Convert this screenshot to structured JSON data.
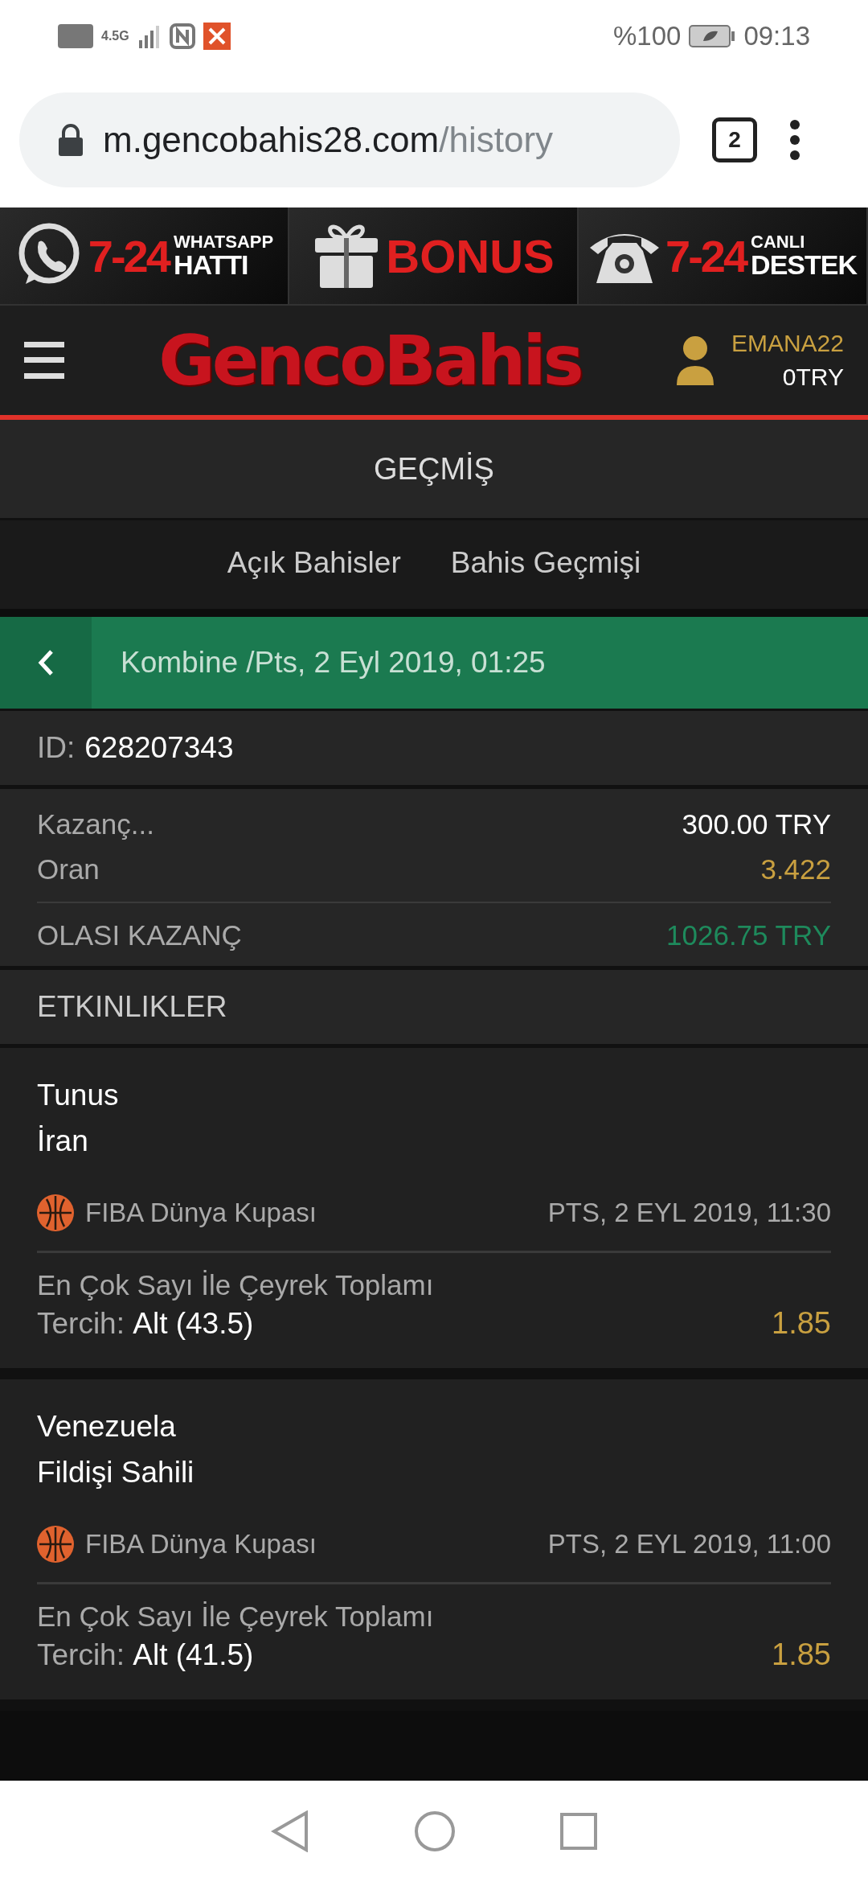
{
  "status_bar": {
    "network": "4.5G",
    "battery": "%100",
    "time": "09:13"
  },
  "browser": {
    "url_host": "m.gencobahis28.com",
    "url_path": "/history",
    "tab_count": "2"
  },
  "banner": [
    {
      "kind": "whatsapp",
      "number": "7-24",
      "line1": "WHATSAPP",
      "line2": "HATTI"
    },
    {
      "kind": "gift",
      "line1": "BONUS"
    },
    {
      "kind": "phone",
      "number": "7-24",
      "line1": "CANLI",
      "line2": "DESTEK"
    }
  ],
  "header": {
    "logo": "GencoBahis",
    "username": "EMANA22",
    "balance": "0TRY"
  },
  "page_title": "GEÇMİŞ",
  "tabs": [
    {
      "label": "Açık Bahisler",
      "selected": false
    },
    {
      "label": "Bahis Geçmişi",
      "selected": false
    }
  ],
  "bet": {
    "title": "Kombine /Pts, 2 Eyl 2019, 01:25",
    "id_label": "ID:",
    "id": "628207343",
    "stake_label": "Kazanç...",
    "stake": "300.00 TRY",
    "odds_label": "Oran",
    "odds": "3.422",
    "win_label": "OLASI KAZANÇ",
    "win": "1026.75 TRY"
  },
  "events_title": "ETKINLIKLER",
  "events": [
    {
      "team1": "Tunus",
      "team2": "İran",
      "league": "FIBA Dünya Kupası",
      "date": "PTS, 2 EYL 2019, 11:30",
      "market": "En Çok Sayı İle Çeyrek Toplamı",
      "choice_label": "Tercih:",
      "choice": "Alt (43.5)",
      "odds": "1.85"
    },
    {
      "team1": "Venezuela",
      "team2": "Fildişi Sahili",
      "league": "FIBA Dünya Kupası",
      "date": "PTS, 2 EYL 2019, 11:00",
      "market": "En Çok Sayı İle Çeyrek Toplamı",
      "choice_label": "Tercih:",
      "choice": "Alt (41.5)",
      "odds": "1.85"
    }
  ]
}
